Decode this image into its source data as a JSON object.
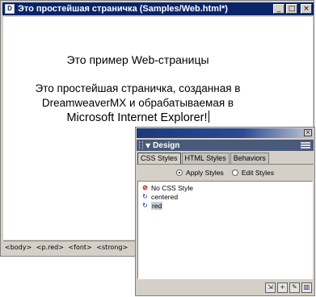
{
  "document": {
    "title": "Это простейшая страничка (Samples/Web.html*)",
    "window_buttons": {
      "minimize": "_",
      "maximize": "□",
      "close": "×"
    },
    "heading": "Это пример Web-страницы",
    "paragraph_line1": "Это простейшая страничка, созданная в",
    "paragraph_line2": "DreamweaverMX и обрабатываемая в",
    "paragraph_line3": "Microsoft Internet Explorer!",
    "tag_selector": [
      "<body>",
      "<p.red>",
      "<font>",
      "<strong>"
    ]
  },
  "panel": {
    "close": "×",
    "header": "Design",
    "tabs": [
      "CSS Styles",
      "HTML Styles",
      "Behaviors"
    ],
    "radio_apply": "Apply Styles",
    "radio_edit": "Edit Styles",
    "styles": [
      "No CSS Style",
      "centered",
      "red"
    ],
    "footer_buttons": [
      "attach-style-sheet",
      "new-style",
      "edit-style-sheet",
      "delete-style"
    ]
  },
  "colors": {
    "titlebar": "#0a246a",
    "panel_header": "#4a5a7a",
    "selected_item": "#c8d0e0"
  }
}
